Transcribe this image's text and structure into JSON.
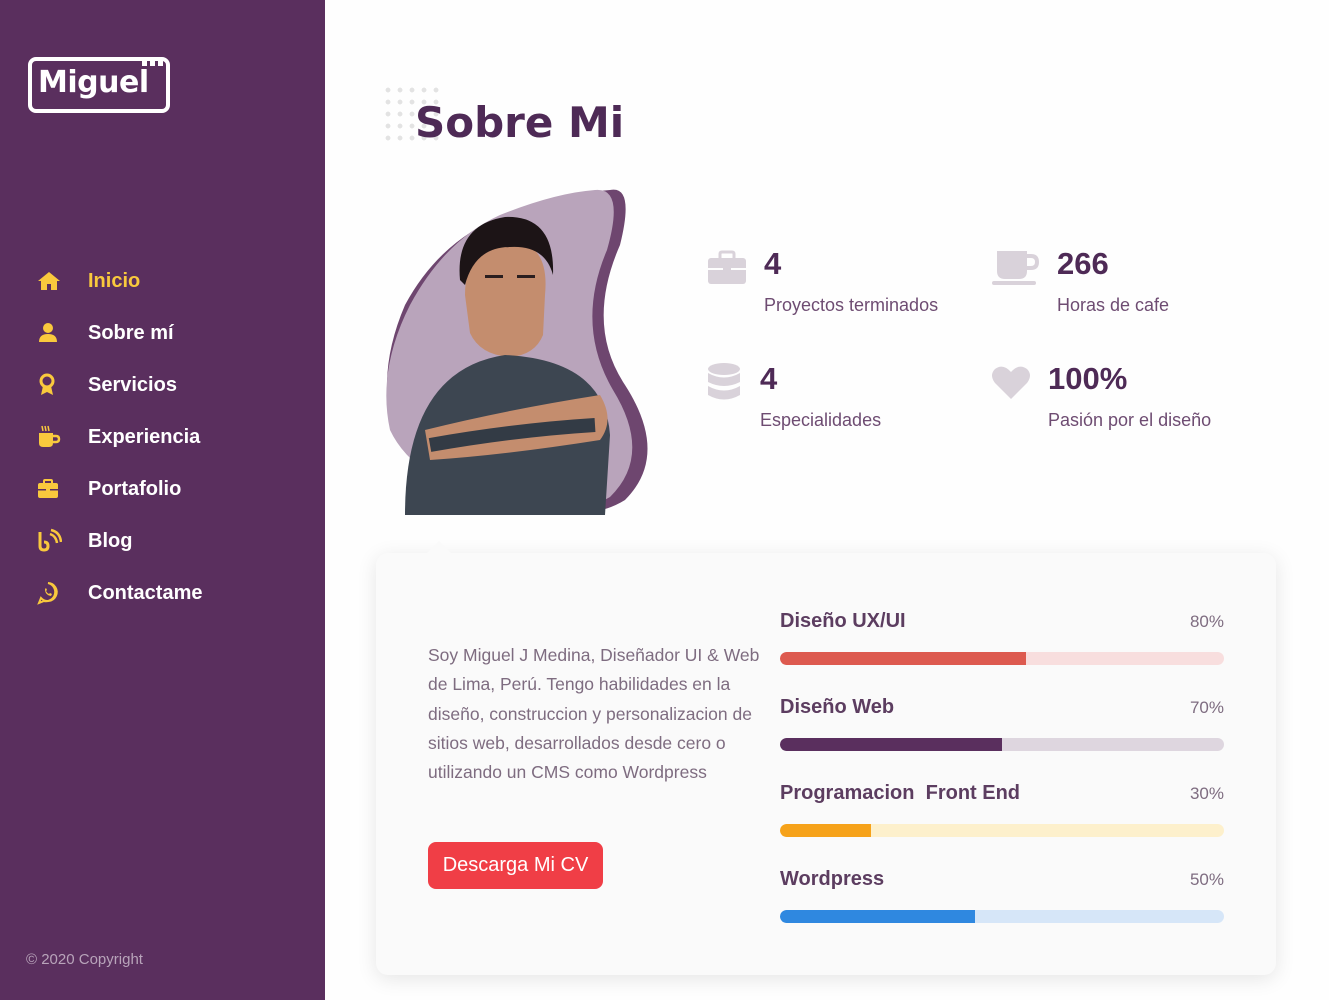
{
  "sidebar": {
    "logo_text": "Miguel",
    "items": [
      {
        "label": "Inicio",
        "icon": "home-icon",
        "active": true
      },
      {
        "label": "Sobre mí",
        "icon": "user-icon",
        "active": false
      },
      {
        "label": "Servicios",
        "icon": "award-icon",
        "active": false
      },
      {
        "label": "Experiencia",
        "icon": "coffee-icon",
        "active": false
      },
      {
        "label": "Portafolio",
        "icon": "briefcase-icon",
        "active": false
      },
      {
        "label": "Blog",
        "icon": "rss-icon",
        "active": false
      },
      {
        "label": "Contactame",
        "icon": "whatsapp-icon",
        "active": false
      }
    ],
    "copyright": "© 2020 Copyright"
  },
  "main": {
    "title": "Sobre Mi",
    "stats": [
      {
        "value": "4",
        "label": "Proyectos terminados",
        "icon": "briefcase-icon"
      },
      {
        "value": "266",
        "label": "Horas de cafe",
        "icon": "coffee-cup-icon"
      },
      {
        "value": "4",
        "label": "Especialidades",
        "icon": "database-icon"
      },
      {
        "value": "100%",
        "label": "Pasión por el diseño",
        "icon": "heart-icon"
      }
    ],
    "bio": "Soy Miguel J Medina, Diseñador UI & Web de Lima, Perú. Tengo habilidades en la diseño, construccion y personalizacion de sitios web, desarrollados desde cero o utilizando un CMS como Wordpress",
    "cv_button": "Descarga Mi CV",
    "skills": [
      {
        "name": "Diseño UX/UI",
        "percent_label": "80%",
        "level": 0.555,
        "color": "#dd5a4f",
        "track": "#f8dede"
      },
      {
        "name": "Diseño Web",
        "percent_label": "70%",
        "level": 0.5,
        "color": "#5a2f5e",
        "track": "#ded6df"
      },
      {
        "name": "Programacion  Front End",
        "percent_label": "30%",
        "level": 0.205,
        "color": "#f6a21a",
        "track": "#fdf0cc"
      },
      {
        "name": "Wordpress",
        "percent_label": "50%",
        "level": 0.44,
        "color": "#2f88e0",
        "track": "#d6e6f8"
      }
    ]
  },
  "colors": {
    "sidebar_bg": "#5a2f5e",
    "active_nav": "#f9c93d",
    "accent": "#f03e46",
    "heading": "#4e2a56"
  }
}
